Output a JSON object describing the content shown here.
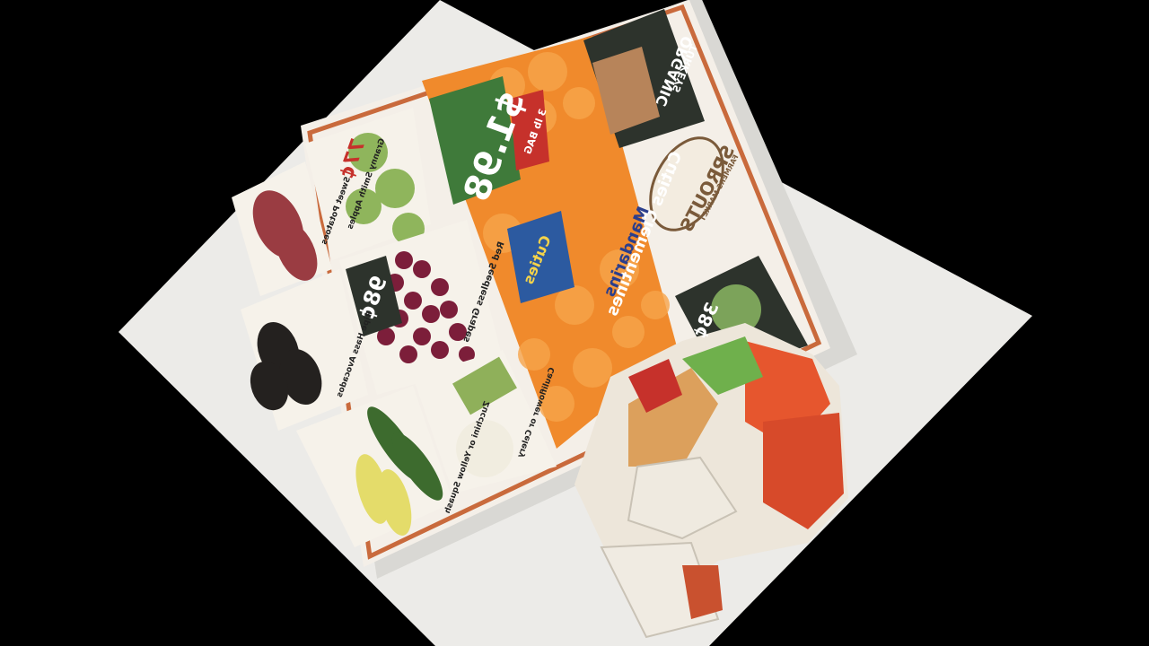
{
  "photo": {
    "subject": "Mirrored grocery flyer on a white table beside a crumpled printed ad",
    "colors": {
      "background": "#000000",
      "table": "#ecebe8",
      "flyer_border": "#c96a3c",
      "orange": "#f08a2c",
      "green_badge": "#3f7a3a",
      "red_badge": "#c6312b",
      "dark_badge": "#2d332c"
    }
  },
  "flyer": {
    "brand": "SPROUTS",
    "brand_sub": "FARMERS MARKET",
    "headline_1": "Cuties Clementines",
    "headline_2": "Mandarins",
    "bag_price": "$1.98",
    "bag_label": "3 lb BAG",
    "cuties_logo": "Cuties",
    "organic": "ORGANIC",
    "turkeys": "TURKEYS",
    "grapes_price": "98¢",
    "grapes_label": "Red Seedless Grapes",
    "apples_label": "Granny Smith Apples",
    "potatoes_label": "Sweet Potatoes",
    "avocados_label": "Ripe Hass Avocados",
    "cauliflower_label": "Cauliflower or Celery",
    "squash_label": "Zucchini or Yellow Squash",
    "misc_price_1": "77¢",
    "misc_price_2": "38¢"
  }
}
